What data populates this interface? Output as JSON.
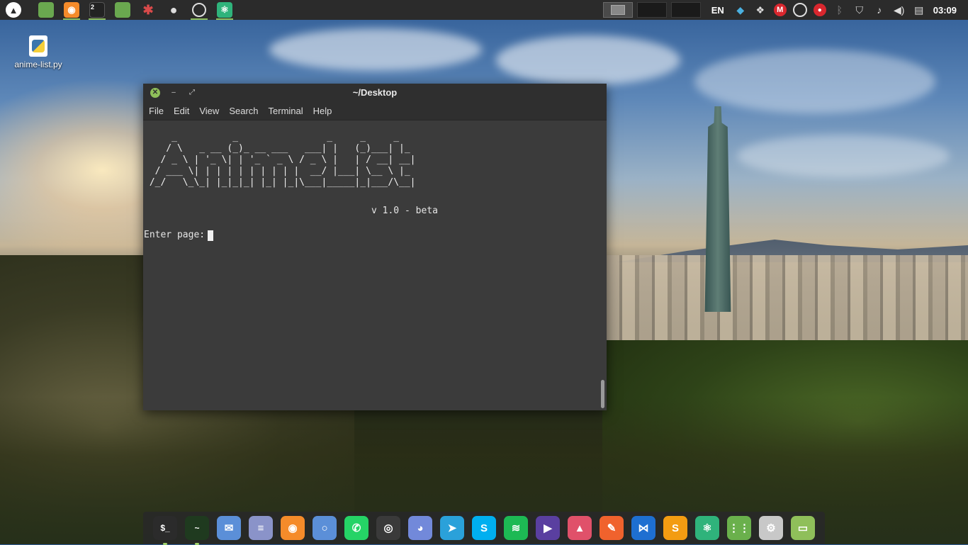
{
  "top_panel": {
    "launchers": [
      {
        "name": "menu-icon",
        "color": "#ffffff"
      },
      {
        "name": "files-icon",
        "color": "#6aa84f"
      },
      {
        "name": "firefox-icon",
        "color": "#f58b2a"
      },
      {
        "name": "terminal-icon",
        "color": "#222222",
        "badge": "2"
      },
      {
        "name": "folder-icon",
        "color": "#6aa84f"
      },
      {
        "name": "spider-icon",
        "color": "#d94a4a"
      },
      {
        "name": "bird-icon",
        "color": "#cccccc"
      },
      {
        "name": "obs-icon",
        "color": "#dddddd"
      },
      {
        "name": "atom-icon",
        "color": "#2fb37b"
      }
    ],
    "keyboard_layout": "EN",
    "clock": "03:09"
  },
  "desktop": {
    "file_label": "anime-list.py"
  },
  "terminal": {
    "title": "~/Desktop",
    "menu": [
      "File",
      "Edit",
      "View",
      "Search",
      "Terminal",
      "Help"
    ],
    "ascii_art": "     _          _                _     _     _   \n    / \\   _ __ (_)_ __ ___   ___| |   (_)___| |_ \n   / _ \\ | '_ \\| | '_ ` _ \\ / _ \\ |   | / __| __|\n  / ___ \\| | | | | | | | | |  __/ |___| \\__ \\ |_ \n /_/   \\_\\_| |_|_|_| |_| |_|\\___|_____|_|___/\\__|",
    "version": "v 1.0 - beta",
    "prompt": "Enter page:"
  },
  "dock": {
    "apps": [
      {
        "name": "terminal-dock-icon",
        "glyph": "$_",
        "color": "#2b2b2b"
      },
      {
        "name": "system-monitor-icon",
        "glyph": "~",
        "color": "#1f3a1f"
      },
      {
        "name": "mail-icon",
        "glyph": "✉",
        "color": "#5b8fd8"
      },
      {
        "name": "text-editor-icon",
        "glyph": "≡",
        "color": "#8a93c9"
      },
      {
        "name": "firefox-dock-icon",
        "glyph": "◉",
        "color": "#f58b2a"
      },
      {
        "name": "chromium-icon",
        "glyph": "○",
        "color": "#5b8fd8"
      },
      {
        "name": "whatsapp-icon",
        "glyph": "✆",
        "color": "#25d366"
      },
      {
        "name": "obs-dock-icon",
        "glyph": "◎",
        "color": "#3a3a3a"
      },
      {
        "name": "discord-icon",
        "glyph": "◕",
        "color": "#7289da"
      },
      {
        "name": "telegram-icon",
        "glyph": "➤",
        "color": "#2aa1da"
      },
      {
        "name": "skype-icon",
        "glyph": "S",
        "color": "#00aff0"
      },
      {
        "name": "spotify-icon",
        "glyph": "≋",
        "color": "#1db954"
      },
      {
        "name": "video-player-icon",
        "glyph": "▶",
        "color": "#5a3fa0"
      },
      {
        "name": "image-viewer-icon",
        "glyph": "▲",
        "color": "#e0516a"
      },
      {
        "name": "inkscape-icon",
        "glyph": "✎",
        "color": "#f0622d"
      },
      {
        "name": "vscode-icon",
        "glyph": "⋈",
        "color": "#1e6fd1"
      },
      {
        "name": "sublime-icon",
        "glyph": "S",
        "color": "#f39c12"
      },
      {
        "name": "atom-dock-icon",
        "glyph": "⚛",
        "color": "#2fb37b"
      },
      {
        "name": "app-grid-icon",
        "glyph": "⋮⋮",
        "color": "#6ab04c"
      },
      {
        "name": "settings-icon",
        "glyph": "⚙",
        "color": "#c8c8c8"
      },
      {
        "name": "files-dock-icon",
        "glyph": "▭",
        "color": "#8fbf5a"
      }
    ]
  }
}
